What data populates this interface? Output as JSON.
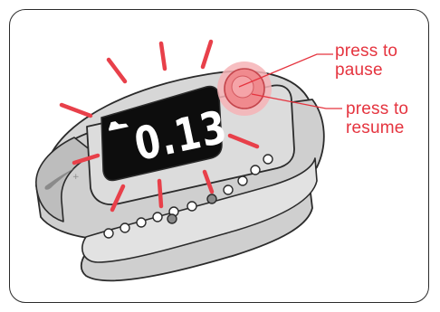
{
  "display": {
    "distance": "0.13"
  },
  "callouts": {
    "pause": "press to\npause",
    "resume": "press to\nresume"
  },
  "icons": {
    "runner": "runner-shoe-icon",
    "brand": "swoosh-logo-icon",
    "button": "start-stop-button-icon"
  },
  "colors": {
    "accent": "#e5343f",
    "flash_rays": "#e8404a",
    "button": "#f08a8e",
    "band": "#cfcfcf",
    "display": "#0d0d0d"
  }
}
